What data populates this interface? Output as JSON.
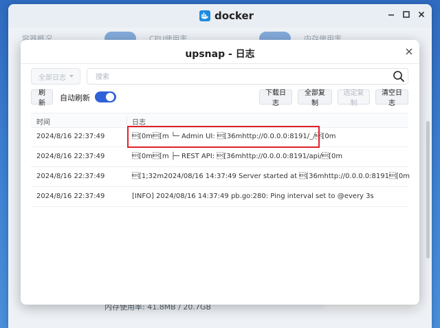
{
  "docker": {
    "title": "docker",
    "bg_tabs": [
      "容器概况",
      "CPU使用率",
      "内存使用率"
    ],
    "footer_text": "内存使用率:  41.8MB / 20.7GB"
  },
  "modal": {
    "title": "upsnap - 日志",
    "filter_label": "全部日志",
    "search_placeholder": "搜索",
    "buttons": {
      "refresh": "刷新",
      "auto_refresh_label": "自动刷新",
      "download": "下载日志",
      "copy_all": "全部复制",
      "copy_selected": "选定复制",
      "clear": "清空日志"
    },
    "auto_refresh_on": true,
    "columns": {
      "time": "时间",
      "log": "日志"
    },
    "rows": [
      {
        "time": "2024/8/16 22:37:49",
        "log": "\u001b[0m\u001b[m └─ Admin UI: \u001b[36mhttp://0.0.0.0:8191/_/\u001b[0m"
      },
      {
        "time": "2024/8/16 22:37:49",
        "log": "\u001b[0m\u001b[m ├─ REST API: \u001b[36mhttp://0.0.0.0:8191/api/\u001b[0m"
      },
      {
        "time": "2024/8/16 22:37:49",
        "log": "\u001b[1;32m2024/08/16 14:37:49 Server started at \u001b[36mhttp://0.0.0.0:8191\u001b[0m"
      },
      {
        "time": "2024/8/16 22:37:49",
        "log": "[INFO] 2024/08/16 14:37:49 pb.go:280: Ping interval set to @every 3s"
      }
    ]
  },
  "colors": {
    "accent": "#2f62d8",
    "highlight": "#e0202a"
  }
}
